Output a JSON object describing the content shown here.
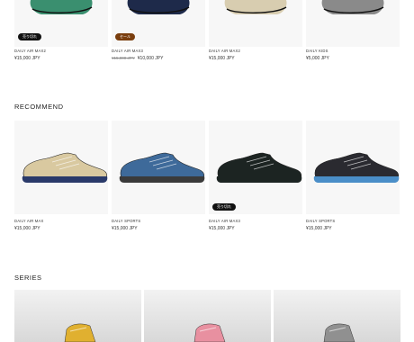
{
  "top_products": [
    {
      "name": "DAILY AIR MAX2",
      "price": "¥15,000 JPY",
      "old_price": "",
      "badge": "売り切れ",
      "badge_type": "soldout",
      "shoe_color": "#3a8f6f"
    },
    {
      "name": "DAILY AIR MAX3",
      "price": "¥10,000 JPY",
      "old_price": "¥15,000 JPY",
      "badge": "セール",
      "badge_type": "sale",
      "shoe_color": "#1e2a4a"
    },
    {
      "name": "DAILY AIR MAX2",
      "price": "¥15,000 JPY",
      "old_price": "",
      "badge": "",
      "badge_type": "",
      "shoe_color": "#d8cdb0"
    },
    {
      "name": "DAILY KIDS",
      "price": "¥5,000 JPY",
      "old_price": "",
      "badge": "",
      "badge_type": "",
      "shoe_color": "#8a8a8a"
    }
  ],
  "recommend": {
    "title": "RECOMMEND",
    "products": [
      {
        "name": "DAILY AIR MAX",
        "price": "¥15,000 JPY",
        "badge": "",
        "shoe_color": "#d9c9a0",
        "sole_color": "#2a3a6a"
      },
      {
        "name": "DAILY SPORTS",
        "price": "¥15,000 JPY",
        "badge": "",
        "shoe_color": "#3e6a9a",
        "sole_color": "#3a3a3a"
      },
      {
        "name": "DAILY AIR MAX3",
        "price": "¥15,000 JPY",
        "badge": "売り切れ",
        "shoe_color": "#1c2422",
        "sole_color": "#1c2422"
      },
      {
        "name": "DAILY SPORTS",
        "price": "¥15,000 JPY",
        "badge": "",
        "shoe_color": "#2a2a30",
        "sole_color": "#4a8ec8"
      }
    ]
  },
  "series": {
    "title": "SERIES",
    "items": [
      {
        "name": "series-1",
        "shoe_color": "#e0b030"
      },
      {
        "name": "series-2",
        "shoe_color": "#e890a0"
      },
      {
        "name": "series-3",
        "shoe_color": "#909090"
      }
    ]
  }
}
